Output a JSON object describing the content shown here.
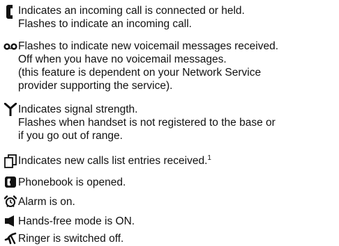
{
  "entries": [
    {
      "icon": "handset-icon",
      "lines": [
        "Indicates an incoming call is connected or held.",
        "Flashes to indicate an incoming call."
      ]
    },
    {
      "icon": "voicemail-icon",
      "lines": [
        "Flashes to indicate new voicemail messages received.",
        "Off when you have no voicemail messages.",
        "(this feature is dependent on your Network Service",
        "provider supporting the service)."
      ]
    },
    {
      "icon": "signal-antenna-icon",
      "lines": [
        "Indicates signal strength.",
        "Flashes when handset is not registered to the base or",
        "if you go out of range."
      ]
    },
    {
      "icon": "calls-list-icon",
      "lines": [
        "Indicates new calls list entries received."
      ],
      "footnote": "1"
    },
    {
      "icon": "phonebook-icon",
      "lines": [
        "Phonebook is opened."
      ]
    },
    {
      "icon": "alarm-clock-icon",
      "lines": [
        "Alarm is on."
      ]
    },
    {
      "icon": "speaker-icon",
      "lines": [
        "Hands-free mode is ON."
      ]
    },
    {
      "icon": "ringer-off-icon",
      "lines": [
        "Ringer is switched off."
      ]
    }
  ]
}
